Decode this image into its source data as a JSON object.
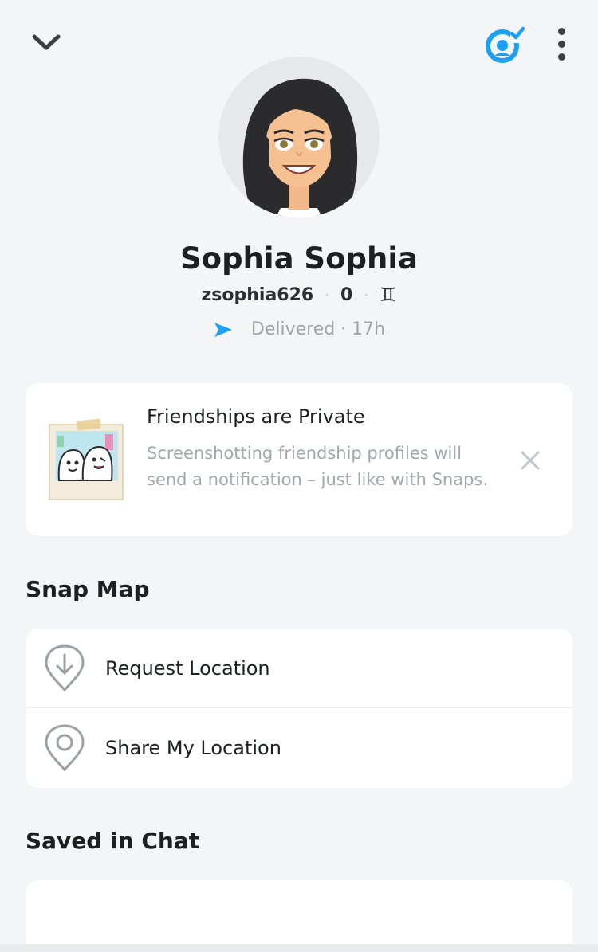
{
  "header": {
    "back_icon": "chevron-down-icon",
    "friend_icon": "friend-check-icon",
    "more_icon": "more-vertical-icon"
  },
  "profile": {
    "display_name": "Sophia Sophia",
    "username": "zsophia626",
    "snap_score": "0",
    "zodiac": "♊",
    "status_icon": "delivered-arrow-icon",
    "status_text": "Delivered · 17h"
  },
  "privacy_notice": {
    "title": "Friendships are Private",
    "body": "Screenshotting friendship profiles will send a notification – just like with Snaps."
  },
  "snap_map": {
    "title": "Snap Map",
    "items": [
      {
        "label": "Request Location",
        "icon": "location-request-icon"
      },
      {
        "label": "Share My Location",
        "icon": "location-pin-icon"
      }
    ]
  },
  "saved_in_chat": {
    "title": "Saved in Chat"
  },
  "colors": {
    "accent_blue": "#1ea0f2",
    "background": "#f4f5f6",
    "card": "#ffffff",
    "text_primary": "#1d1f22",
    "text_secondary": "#9fa3a8"
  }
}
